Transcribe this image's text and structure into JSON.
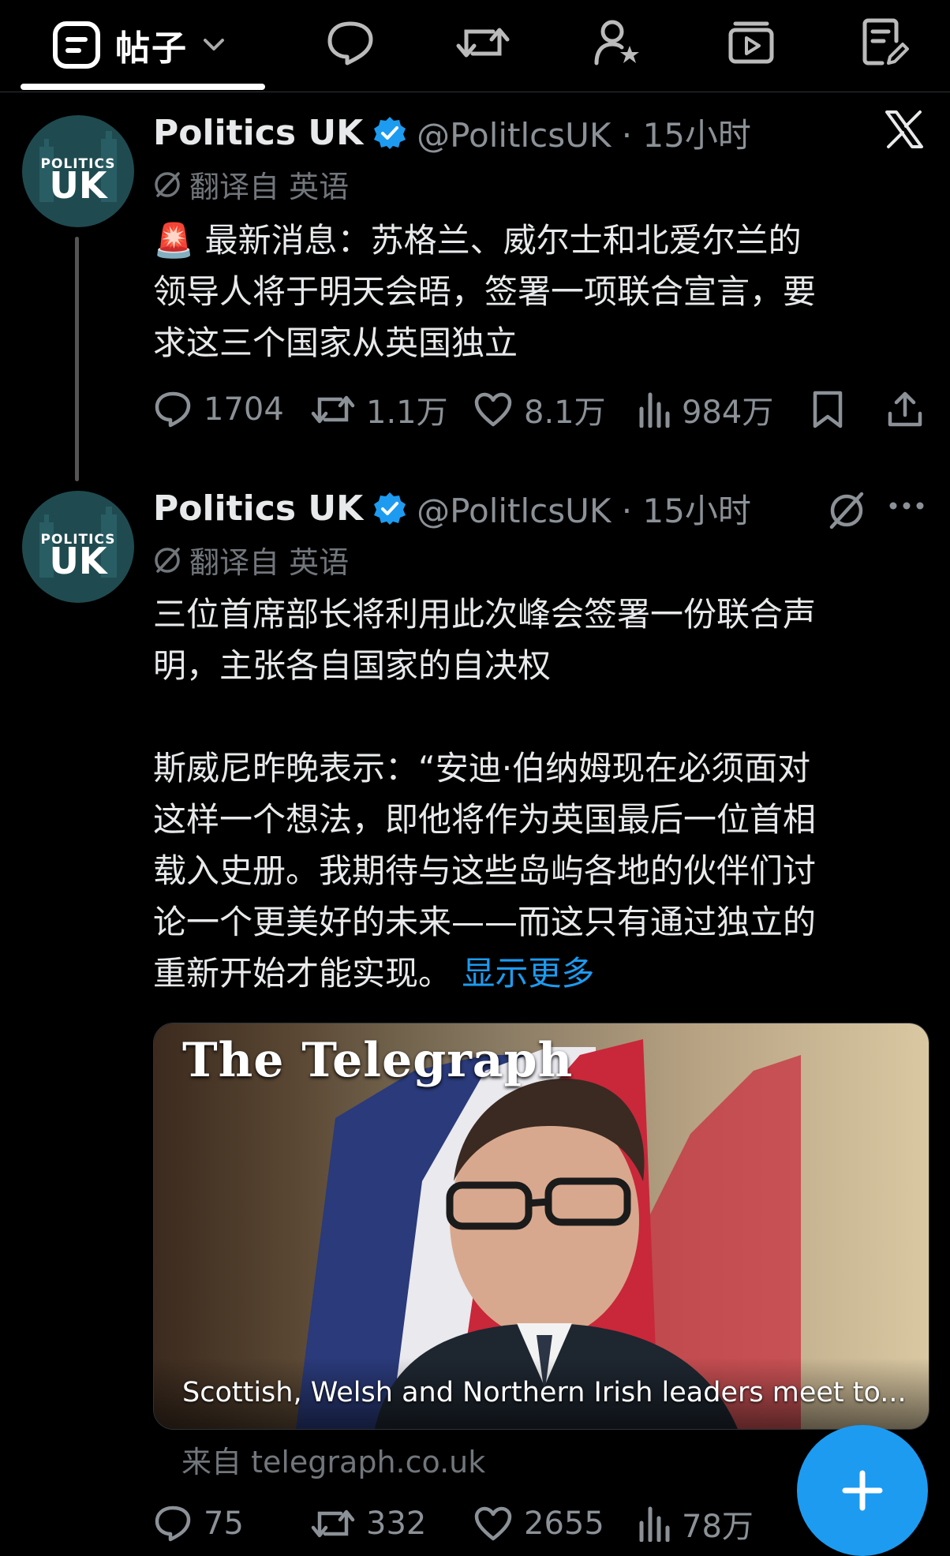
{
  "topbar": {
    "active_tab_label": "帖子"
  },
  "tweets": [
    {
      "avatar": {
        "line1": "POLITICS",
        "line2": "UK"
      },
      "name": "Politics UK",
      "handle": "@PolitlcsUK · 15小时",
      "translated": "翻译自 英语",
      "body_lines": [
        "🚨 最新消息：苏格兰、威尔士和北爱尔兰的",
        "领导人将于明天会晤，签署一项联合宣言，要",
        "求这三个国家从英国独立"
      ],
      "stats": {
        "replies": "1704",
        "reposts": "1.1万",
        "likes": "8.1万",
        "views": "984万"
      }
    },
    {
      "avatar": {
        "line1": "POLITICS",
        "line2": "UK"
      },
      "name": "Politics UK",
      "handle": "@PolitlcsUK · 15小时",
      "translated": "翻译自 英语",
      "body_lines_a": [
        "三位首席部长将利用此次峰会签署一份联合声",
        "明，主张各自国家的自决权"
      ],
      "body_lines_b": [
        "斯威尼昨晚表示：“安迪·伯纳姆现在必须面对",
        "这样一个想法，即他将作为英国最后一位首相",
        "载入史册。我期待与这些岛屿各地的伙伴们讨",
        "论一个更美好的未来——而这只有通过独立的"
      ],
      "body_last": "重新开始才能实现。",
      "show_more": "显示更多",
      "card": {
        "masthead": "The Telegraph",
        "title": "Scottish, Welsh and Northern Irish leaders meet to..."
      },
      "source": "来自 telegraph.co.uk",
      "stats": {
        "replies": "75",
        "reposts": "332",
        "likes": "2655",
        "views": "78万"
      }
    }
  ],
  "colors": {
    "accent": "#1d9bf0",
    "background": "#000000",
    "muted": "#71767b"
  }
}
